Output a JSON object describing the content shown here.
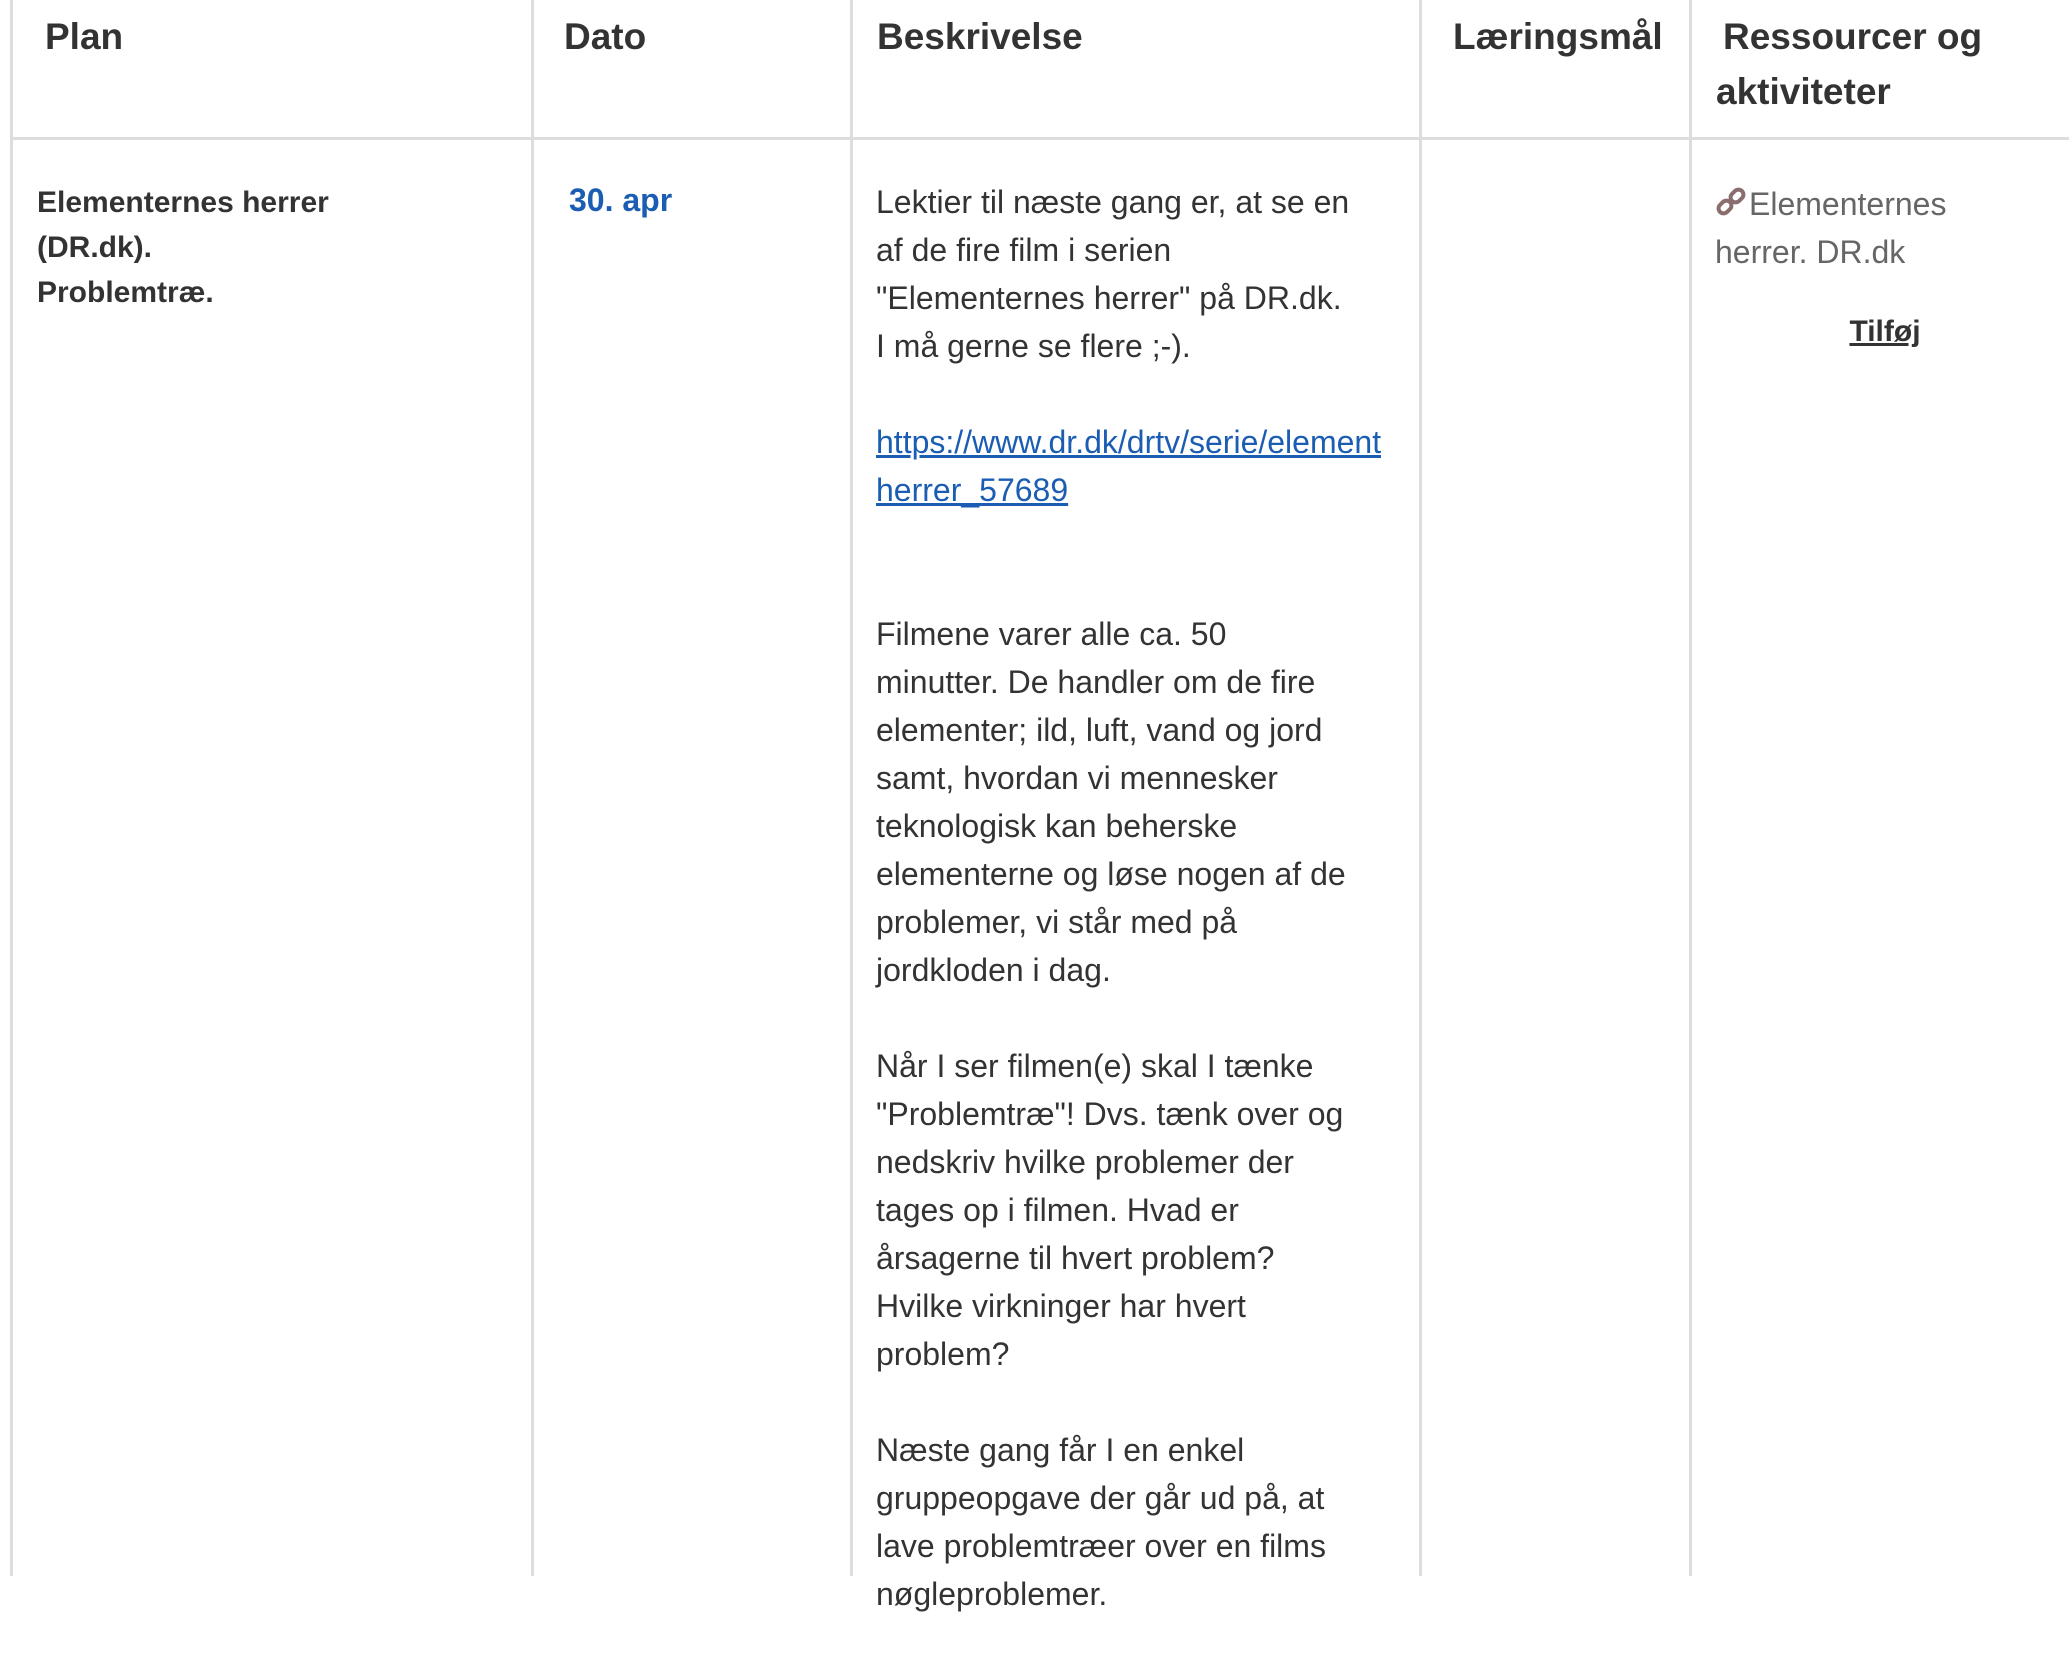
{
  "headers": {
    "plan": "Plan",
    "date": "Dato",
    "description": "Beskrivelse",
    "goals": "Læringsmål",
    "resources_line1": "Ressourcer og",
    "resources_line2": "aktiviteter"
  },
  "row": {
    "plan_lines": [
      "Elementernes herrer",
      "(DR.dk).",
      "Problemtræ."
    ],
    "date": "30. apr",
    "description": {
      "p1": "Lektier til næste gang er, at se en\naf de fire film i serien\n\"Elementernes herrer\" på DR.dk.\nI må gerne se flere ;-).",
      "link_line1": "https://www.dr.dk/drtv/serie/elementernes-",
      "link_line2": "herrer_57689",
      "p2": "Filmene varer alle ca. 50\nminutter. De handler om de fire\nelementer; ild, luft, vand og jord\nsamt, hvordan vi mennesker\nteknologisk kan beherske\nelementerne og løse nogen af de\nproblemer, vi står med på\njordkloden i dag.",
      "p3": "Når I ser filmen(e) skal I tænke\n\"Problemtræ\"! Dvs. tænk over og\nnedskriv hvilke problemer der\ntages op i filmen. Hvad er\nårsagerne til hvert problem?\nHvilke virkninger har hvert\nproblem?",
      "p4": "Næste gang får I en enkel\ngruppeopgave der går ud på, at\nlave problemtræer over en films\nnøgleproblemer."
    },
    "goals": "",
    "resource_icon": "link-icon",
    "resource_line1": "Elementernes",
    "resource_line2": "herrer. DR.dk",
    "add_label": "Tilføj"
  },
  "colors": {
    "link": "#1a5db2",
    "border": "#dddddd",
    "text": "#333333",
    "muted": "#666666"
  }
}
